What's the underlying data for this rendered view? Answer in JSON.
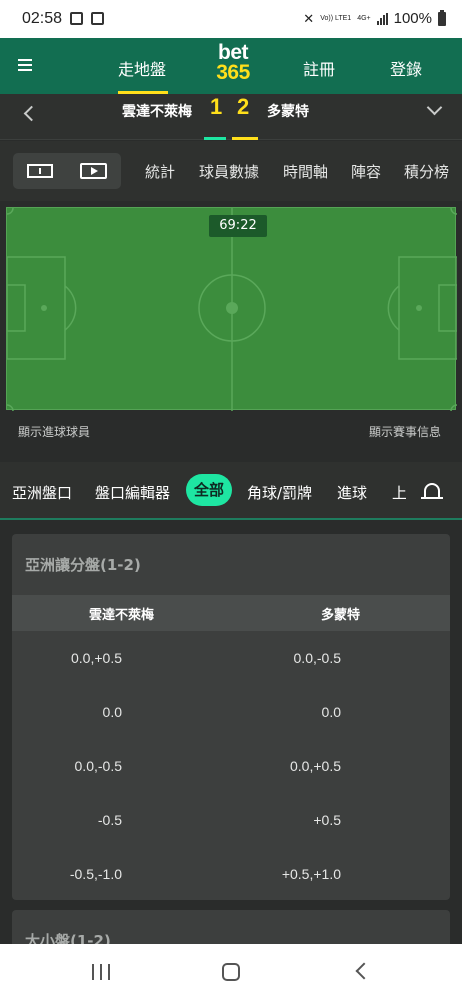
{
  "status_bar": {
    "time": "02:58",
    "network": "4G+",
    "sim": "Vo)) LTE1",
    "battery": "100%"
  },
  "header": {
    "nav": [
      "走地盤",
      "註冊",
      "登錄"
    ],
    "logo_top": "bet",
    "logo_bottom": "365"
  },
  "match": {
    "home_team": "雲達不萊梅",
    "away_team": "多蒙特",
    "home_score": "1",
    "away_score": "2"
  },
  "stats_tabs": [
    "統計",
    "球員數據",
    "時間軸",
    "陣容",
    "積分榜"
  ],
  "pitch": {
    "clock": "69:22",
    "show_scorers": "顯示進球球員",
    "show_match_info": "顯示賽事信息"
  },
  "market_tabs": [
    "亞洲盤口",
    "盤口編輯器",
    "全部",
    "角球/罰牌",
    "進球",
    "上"
  ],
  "asian_handicap": {
    "title": "亞洲讓分盤(1-2)",
    "columns": [
      "雲達不萊梅",
      "多蒙特"
    ],
    "rows": [
      [
        "0.0,+0.5",
        "0.0,-0.5"
      ],
      [
        "0.0",
        "0.0"
      ],
      [
        "0.0,-0.5",
        "0.0,+0.5"
      ],
      [
        "-0.5",
        "+0.5"
      ],
      [
        "-0.5,-1.0",
        "+0.5,+1.0"
      ]
    ]
  },
  "next_card": {
    "title": "大小盤(1-2)"
  },
  "colors": {
    "header_green": "#126e51",
    "accent_yellow": "#ffdf1b",
    "active_tab": "#1ee6a2",
    "pitch": "#3c8d3d"
  }
}
